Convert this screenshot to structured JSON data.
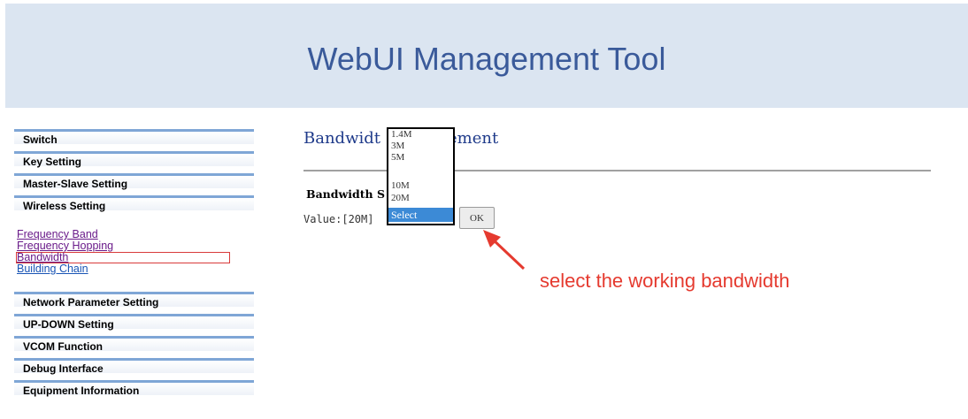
{
  "header": {
    "title": "WebUI Management Tool"
  },
  "sidebar": {
    "top_items": [
      {
        "label": "Switch"
      },
      {
        "label": "Key Setting"
      },
      {
        "label": "Master-Slave Setting"
      },
      {
        "label": "Wireless Setting"
      }
    ],
    "sub_items": [
      {
        "label": "Frequency Band"
      },
      {
        "label": "Frequency Hopping"
      },
      {
        "label": "Bandwidth"
      },
      {
        "label": "Building Chain"
      }
    ],
    "bottom_items": [
      {
        "label": "Network Parameter Setting"
      },
      {
        "label": "UP-DOWN Setting"
      },
      {
        "label": "VCOM Function"
      },
      {
        "label": "Debug Interface"
      },
      {
        "label": "Equipment Information"
      }
    ]
  },
  "main": {
    "title_left": "Bandwidt",
    "title_right": "ement",
    "section_label": "Bandwidth S",
    "value_label": "Value:[20M]",
    "ok_label": "OK",
    "dropdown_options": [
      {
        "label": "1.4M"
      },
      {
        "label": "3M"
      },
      {
        "label": "5M"
      },
      {
        "label": "10M"
      },
      {
        "label": "20M"
      }
    ],
    "dropdown_selected": "Select"
  },
  "annotation": {
    "text": "select the working bandwidth"
  },
  "colors": {
    "header_bg": "#dbe5f1",
    "title": "#3a5a9a",
    "annotation": "#e53a2f",
    "highlight": "#3c8ad6"
  }
}
